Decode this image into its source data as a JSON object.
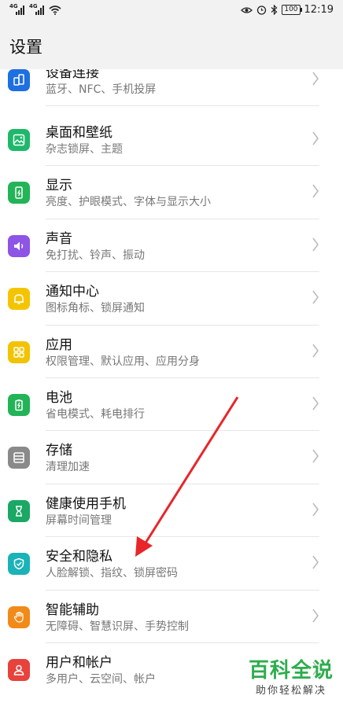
{
  "status_bar": {
    "time": "12:19",
    "battery": "100",
    "signal1_label": "4G",
    "signal2_label": "4G"
  },
  "page": {
    "title": "设置"
  },
  "settings": [
    {
      "title": "设备连接",
      "subtitle": "蓝牙、NFC、手机投屏",
      "icon": "device-connect-icon",
      "color": "#1e6fe0"
    },
    {
      "title": "桌面和壁纸",
      "subtitle": "杂志锁屏、主题",
      "icon": "wallpaper-icon",
      "color": "#1fb86b"
    },
    {
      "title": "显示",
      "subtitle": "亮度、护眼模式、字体与显示大小",
      "icon": "display-icon",
      "color": "#22b457"
    },
    {
      "title": "声音",
      "subtitle": "免打扰、铃声、振动",
      "icon": "sound-icon",
      "color": "#8d54e6"
    },
    {
      "title": "通知中心",
      "subtitle": "图标角标、锁屏通知",
      "icon": "notification-bell-icon",
      "color": "#f5c400"
    },
    {
      "title": "应用",
      "subtitle": "权限管理、默认应用、应用分身",
      "icon": "apps-grid-icon",
      "color": "#f2c300"
    },
    {
      "title": "电池",
      "subtitle": "省电模式、耗电排行",
      "icon": "battery-icon",
      "color": "#22b457"
    },
    {
      "title": "存储",
      "subtitle": "清理加速",
      "icon": "storage-icon",
      "color": "#8a8a8a"
    },
    {
      "title": "健康使用手机",
      "subtitle": "屏幕时间管理",
      "icon": "hourglass-icon",
      "color": "#1aa864"
    },
    {
      "title": "安全和隐私",
      "subtitle": "人脸解锁、指纹、锁屏密码",
      "icon": "shield-icon",
      "color": "#19b3b8"
    },
    {
      "title": "智能辅助",
      "subtitle": "无障碍、智慧识屏、手势控制",
      "icon": "hand-icon",
      "color": "#f28a1a"
    },
    {
      "title": "用户和帐户",
      "subtitle": "多用户、云空间、帐户",
      "icon": "user-account-icon",
      "color": "#e8423c"
    }
  ],
  "watermark": {
    "main": "百科全说",
    "sub": "助你轻松解决"
  },
  "annotation": {
    "color": "#e8262a"
  }
}
